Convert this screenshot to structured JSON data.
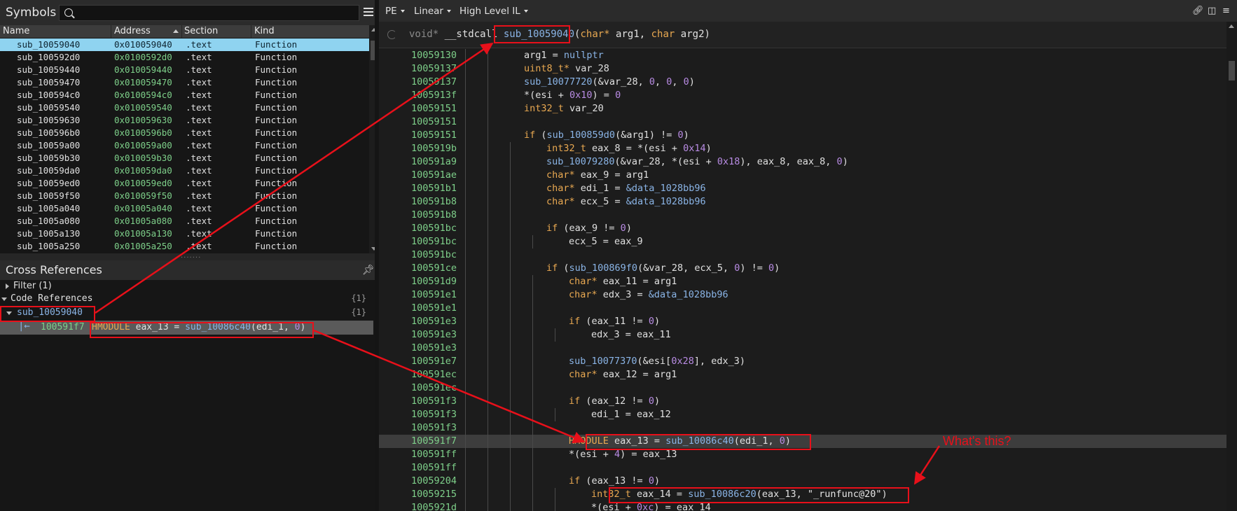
{
  "symbols": {
    "title": "Symbols",
    "search_placeholder": "",
    "columns": [
      "Name",
      "Address",
      "Section",
      "Kind"
    ],
    "rows": [
      {
        "name": "sub_10059040",
        "address": "0x010059040",
        "section": ".text",
        "kind": "Function"
      },
      {
        "name": "sub_100592d0",
        "address": "0x0100592d0",
        "section": ".text",
        "kind": "Function"
      },
      {
        "name": "sub_10059440",
        "address": "0x010059440",
        "section": ".text",
        "kind": "Function"
      },
      {
        "name": "sub_10059470",
        "address": "0x010059470",
        "section": ".text",
        "kind": "Function"
      },
      {
        "name": "sub_100594c0",
        "address": "0x0100594c0",
        "section": ".text",
        "kind": "Function"
      },
      {
        "name": "sub_10059540",
        "address": "0x010059540",
        "section": ".text",
        "kind": "Function"
      },
      {
        "name": "sub_10059630",
        "address": "0x010059630",
        "section": ".text",
        "kind": "Function"
      },
      {
        "name": "sub_100596b0",
        "address": "0x0100596b0",
        "section": ".text",
        "kind": "Function"
      },
      {
        "name": "sub_10059a00",
        "address": "0x010059a00",
        "section": ".text",
        "kind": "Function"
      },
      {
        "name": "sub_10059b30",
        "address": "0x010059b30",
        "section": ".text",
        "kind": "Function"
      },
      {
        "name": "sub_10059da0",
        "address": "0x010059da0",
        "section": ".text",
        "kind": "Function"
      },
      {
        "name": "sub_10059ed0",
        "address": "0x010059ed0",
        "section": ".text",
        "kind": "Function"
      },
      {
        "name": "sub_10059f50",
        "address": "0x010059f50",
        "section": ".text",
        "kind": "Function"
      },
      {
        "name": "sub_1005a040",
        "address": "0x01005a040",
        "section": ".text",
        "kind": "Function"
      },
      {
        "name": "sub_1005a080",
        "address": "0x01005a080",
        "section": ".text",
        "kind": "Function"
      },
      {
        "name": "sub_1005a130",
        "address": "0x01005a130",
        "section": ".text",
        "kind": "Function"
      },
      {
        "name": "sub_1005a250",
        "address": "0x01005a250",
        "section": ".text",
        "kind": "Function"
      }
    ]
  },
  "xrefs": {
    "title": "Cross References",
    "filter_label": "Filter (1)",
    "code_refs_label": "Code References",
    "code_refs_count": "{1}",
    "func_name": "sub_10059040",
    "func_count": "{1}",
    "ref_address": "100591f7",
    "ref_type": "HMODULE",
    "ref_var": " eax_13 = ",
    "ref_call": "sub_10086c40",
    "ref_args_open": "(edi_1, ",
    "ref_zero": "0",
    "ref_args_close": ")"
  },
  "toolbar": {
    "view_type": "PE",
    "layout": "Linear",
    "il_level": "High Level IL"
  },
  "signature": {
    "ret_type": "void* ",
    "conv": "__stdcall ",
    "func_name": "sub_10059040",
    "p_open": "(",
    "p1_type": "char* ",
    "p1_name": "arg1, ",
    "p2_type": "char ",
    "p2_name": "arg2)"
  },
  "code_lines": [
    {
      "addr": "10059130",
      "indent": 0,
      "tokens": [
        [
          "tx",
          "arg1 = "
        ],
        [
          "fn",
          "nullptr"
        ]
      ]
    },
    {
      "addr": "10059137",
      "indent": 0,
      "tokens": [
        [
          "kw-type",
          "uint8_t*"
        ],
        [
          "tx",
          " var_28"
        ]
      ]
    },
    {
      "addr": "10059137",
      "indent": 0,
      "tokens": [
        [
          "fn",
          "sub_10077720"
        ],
        [
          "tx",
          "(&var_28, "
        ],
        [
          "num",
          "0"
        ],
        [
          "tx",
          ", "
        ],
        [
          "num",
          "0"
        ],
        [
          "tx",
          ", "
        ],
        [
          "num",
          "0"
        ],
        [
          "tx",
          ")"
        ]
      ]
    },
    {
      "addr": "1005913f",
      "indent": 0,
      "tokens": [
        [
          "tx",
          "*(esi + "
        ],
        [
          "num",
          "0x10"
        ],
        [
          "tx",
          ") = "
        ],
        [
          "num",
          "0"
        ]
      ]
    },
    {
      "addr": "10059151",
      "indent": 0,
      "tokens": [
        [
          "kw-type",
          "int32_t"
        ],
        [
          "tx",
          " var_20"
        ]
      ]
    },
    {
      "addr": "10059151",
      "indent": 0,
      "tokens": []
    },
    {
      "addr": "10059151",
      "indent": 0,
      "tokens": [
        [
          "kw-type",
          "if"
        ],
        [
          "tx",
          " ("
        ],
        [
          "fn",
          "sub_100859d0"
        ],
        [
          "tx",
          "(&arg1) != "
        ],
        [
          "num",
          "0"
        ],
        [
          "tx",
          ")"
        ]
      ]
    },
    {
      "addr": "1005919b",
      "indent": 1,
      "tokens": [
        [
          "kw-type",
          "int32_t"
        ],
        [
          "tx",
          " eax_8 = *(esi + "
        ],
        [
          "num",
          "0x14"
        ],
        [
          "tx",
          ")"
        ]
      ]
    },
    {
      "addr": "100591a9",
      "indent": 1,
      "tokens": [
        [
          "fn",
          "sub_10079280"
        ],
        [
          "tx",
          "(&var_28, *(esi + "
        ],
        [
          "num",
          "0x18"
        ],
        [
          "tx",
          "), eax_8, eax_8, "
        ],
        [
          "num",
          "0"
        ],
        [
          "tx",
          ")"
        ]
      ]
    },
    {
      "addr": "100591ae",
      "indent": 1,
      "tokens": [
        [
          "kw-type",
          "char*"
        ],
        [
          "tx",
          " eax_9 = arg1"
        ]
      ]
    },
    {
      "addr": "100591b1",
      "indent": 1,
      "tokens": [
        [
          "kw-type",
          "char*"
        ],
        [
          "tx",
          " edi_1 = "
        ],
        [
          "fn",
          "&data_1028bb96"
        ]
      ]
    },
    {
      "addr": "100591b8",
      "indent": 1,
      "tokens": [
        [
          "kw-type",
          "char*"
        ],
        [
          "tx",
          " ecx_5 = "
        ],
        [
          "fn",
          "&data_1028bb96"
        ]
      ]
    },
    {
      "addr": "100591b8",
      "indent": 1,
      "tokens": []
    },
    {
      "addr": "100591bc",
      "indent": 1,
      "tokens": [
        [
          "kw-type",
          "if"
        ],
        [
          "tx",
          " (eax_9 != "
        ],
        [
          "num",
          "0"
        ],
        [
          "tx",
          ")"
        ]
      ]
    },
    {
      "addr": "100591bc",
      "indent": 2,
      "tokens": [
        [
          "tx",
          "ecx_5 = eax_9"
        ]
      ]
    },
    {
      "addr": "100591bc",
      "indent": 1,
      "tokens": []
    },
    {
      "addr": "100591ce",
      "indent": 1,
      "tokens": [
        [
          "kw-type",
          "if"
        ],
        [
          "tx",
          " ("
        ],
        [
          "fn",
          "sub_100869f0"
        ],
        [
          "tx",
          "(&var_28, ecx_5, "
        ],
        [
          "num",
          "0"
        ],
        [
          "tx",
          ") != "
        ],
        [
          "num",
          "0"
        ],
        [
          "tx",
          ")"
        ]
      ]
    },
    {
      "addr": "100591d9",
      "indent": 2,
      "tokens": [
        [
          "kw-type",
          "char*"
        ],
        [
          "tx",
          " eax_11 = arg1"
        ]
      ]
    },
    {
      "addr": "100591e1",
      "indent": 2,
      "tokens": [
        [
          "kw-type",
          "char*"
        ],
        [
          "tx",
          " edx_3 = "
        ],
        [
          "fn",
          "&data_1028bb96"
        ]
      ]
    },
    {
      "addr": "100591e1",
      "indent": 2,
      "tokens": []
    },
    {
      "addr": "100591e3",
      "indent": 2,
      "tokens": [
        [
          "kw-type",
          "if"
        ],
        [
          "tx",
          " (eax_11 != "
        ],
        [
          "num",
          "0"
        ],
        [
          "tx",
          ")"
        ]
      ]
    },
    {
      "addr": "100591e3",
      "indent": 3,
      "tokens": [
        [
          "tx",
          "edx_3 = eax_11"
        ]
      ]
    },
    {
      "addr": "100591e3",
      "indent": 2,
      "tokens": []
    },
    {
      "addr": "100591e7",
      "indent": 2,
      "tokens": [
        [
          "fn",
          "sub_10077370"
        ],
        [
          "tx",
          "(&esi["
        ],
        [
          "num",
          "0x28"
        ],
        [
          "tx",
          "], edx_3)"
        ]
      ]
    },
    {
      "addr": "100591ec",
      "indent": 2,
      "tokens": [
        [
          "kw-type",
          "char*"
        ],
        [
          "tx",
          " eax_12 = arg1"
        ]
      ]
    },
    {
      "addr": "100591ec",
      "indent": 2,
      "tokens": []
    },
    {
      "addr": "100591f3",
      "indent": 2,
      "tokens": [
        [
          "kw-type",
          "if"
        ],
        [
          "tx",
          " (eax_12 != "
        ],
        [
          "num",
          "0"
        ],
        [
          "tx",
          ")"
        ]
      ]
    },
    {
      "addr": "100591f3",
      "indent": 3,
      "tokens": [
        [
          "tx",
          "edi_1 = eax_12"
        ]
      ]
    },
    {
      "addr": "100591f3",
      "indent": 2,
      "tokens": []
    },
    {
      "addr": "100591f7",
      "indent": 2,
      "hl": true,
      "tokens": [
        [
          "kw-type",
          "HMODULE"
        ],
        [
          "tx",
          " eax_13 = "
        ],
        [
          "fn",
          "sub_10086c40"
        ],
        [
          "tx",
          "(edi_1, "
        ],
        [
          "num",
          "0"
        ],
        [
          "tx",
          ")"
        ]
      ]
    },
    {
      "addr": "100591ff",
      "indent": 2,
      "tokens": [
        [
          "tx",
          "*(esi + "
        ],
        [
          "num",
          "4"
        ],
        [
          "tx",
          ") = eax_13"
        ]
      ]
    },
    {
      "addr": "100591ff",
      "indent": 2,
      "tokens": []
    },
    {
      "addr": "10059204",
      "indent": 2,
      "tokens": [
        [
          "kw-type",
          "if"
        ],
        [
          "tx",
          " (eax_13 != "
        ],
        [
          "num",
          "0"
        ],
        [
          "tx",
          ")"
        ]
      ]
    },
    {
      "addr": "10059215",
      "indent": 3,
      "tokens": [
        [
          "kw-type",
          "int32_t"
        ],
        [
          "tx",
          " eax_14 = "
        ],
        [
          "fn",
          "sub_10086c20"
        ],
        [
          "tx",
          "(eax_13, "
        ],
        [
          "str",
          "\"_runfunc@20\""
        ],
        [
          "tx",
          ")"
        ]
      ]
    },
    {
      "addr": "1005921d",
      "indent": 3,
      "tokens": [
        [
          "tx",
          "*(esi + "
        ],
        [
          "num",
          "0xc"
        ],
        [
          "tx",
          ") = eax_14"
        ]
      ]
    }
  ],
  "annotation": {
    "note": "What's this?",
    "color": "#e8101a"
  }
}
